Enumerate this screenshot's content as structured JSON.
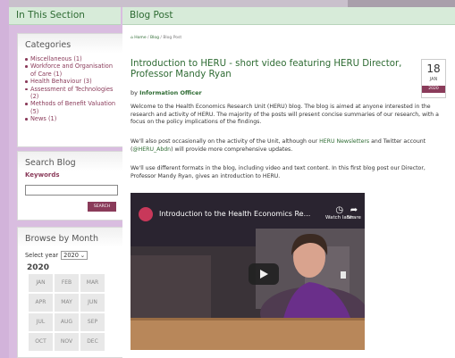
{
  "sidebar": {
    "section_title": "In This Section",
    "categories": {
      "title": "Categories",
      "items": [
        {
          "label": "Miscellaneous",
          "count": "(1)"
        },
        {
          "label": "Workforce and Organisation of Care",
          "count": "(1)"
        },
        {
          "label": "Health Behaviour",
          "count": "(3)"
        },
        {
          "label": "Assessment of Technologies",
          "count": "(2)"
        },
        {
          "label": "Methods of Benefit Valuation",
          "count": "(5)"
        },
        {
          "label": "News",
          "count": "(1)"
        }
      ]
    },
    "search": {
      "title": "Search Blog",
      "keywords_label": "Keywords",
      "input_value": "",
      "button_label": "SEARCH"
    },
    "browse": {
      "title": "Browse by Month",
      "select_label": "Select year",
      "selected_year": "2020",
      "year_heading": "2020",
      "months": [
        "JAN",
        "FEB",
        "MAR",
        "APR",
        "MAY",
        "JUN",
        "JUL",
        "AUG",
        "SEP",
        "OCT",
        "NOV",
        "DEC"
      ]
    }
  },
  "main": {
    "header": "Blog Post",
    "breadcrumb": {
      "home": "Home",
      "sep1": " / ",
      "blog": "Blog",
      "sep2": " / ",
      "current": "Blog Post"
    },
    "post": {
      "title": "Introduction to HERU - short video featuring HERU Director, Professor Mandy Ryan",
      "by": "by",
      "author": "Information Officer",
      "date": {
        "day": "18",
        "month": "JAN",
        "year": "2020"
      },
      "para1": "Welcome to the Health Economics Research Unit (HERU) blog. The blog is aimed at anyone interested in the research and activity of HERU. The majority of the posts will present concise summaries of our research, with a focus on the policy implications of the findings.",
      "para2_a": "We'll also post occasionally on the activity of the Unit, although our ",
      "para2_link1": "HERU Newsletters",
      "para2_b": " and Twitter account (",
      "para2_link2": "@HERU_Abdn",
      "para2_c": ") will provide more comprehensive updates.",
      "para3": "We'll use different formats in the blog, including video and text content. In this first blog post our Director, Professor Mandy Ryan, gives an introduction to HERU."
    },
    "video": {
      "title": "Introduction to the Health Economics Re...",
      "watch_later": "Watch later",
      "share": "Share"
    }
  }
}
